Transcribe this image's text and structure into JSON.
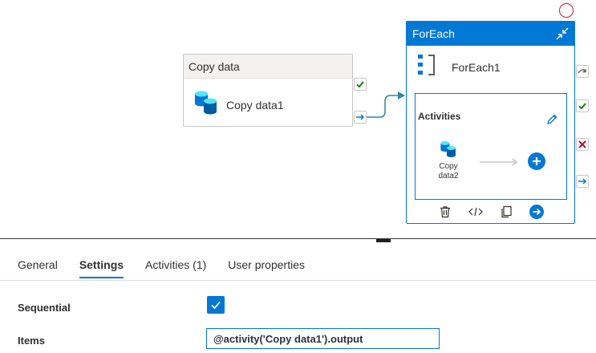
{
  "canvas": {
    "copy_activity": {
      "type_label": "Copy data",
      "name": "Copy data1"
    },
    "foreach_activity": {
      "type_label": "ForEach",
      "name": "ForEach1",
      "activities_title": "Activities",
      "inner_activity": {
        "name": "Copy data2"
      }
    }
  },
  "tabs": [
    {
      "label": "General"
    },
    {
      "label": "Settings",
      "active": true
    },
    {
      "label": "Activities (1)"
    },
    {
      "label": "User properties"
    }
  ],
  "settings": {
    "sequential": {
      "label": "Sequential",
      "checked": true
    },
    "items": {
      "label": "Items",
      "value": "@activity('Copy data1').output"
    }
  },
  "colors": {
    "accent": "#0078d4",
    "success": "#107c10",
    "failure": "#c50f1f",
    "skip": "#605e5c",
    "connector": "#2b88a8"
  },
  "icons": {
    "copy_activity": "database-stack-icon",
    "foreach": "foreach-bracket-icon",
    "collapse": "collapse-arrows-icon",
    "edit": "pencil-icon",
    "add": "plus-circle-icon",
    "delete": "trash-icon",
    "code": "code-icon",
    "clone": "copy-icon",
    "go": "arrow-circle-icon"
  }
}
